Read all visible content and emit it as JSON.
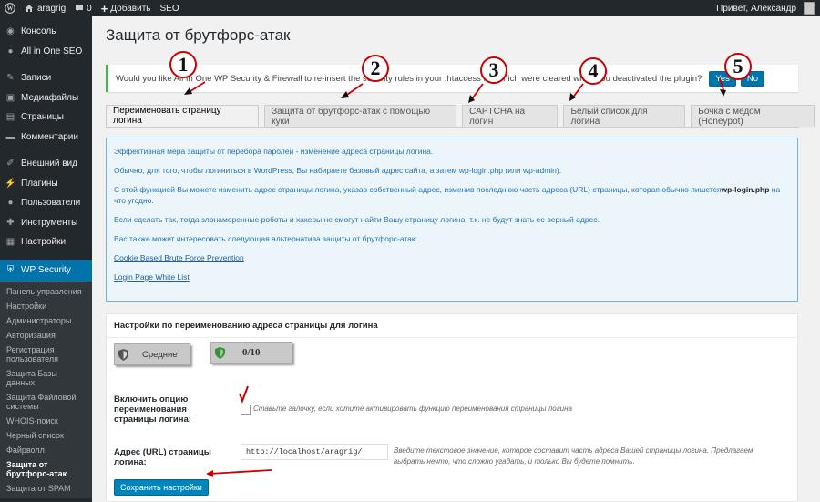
{
  "adminbar": {
    "site": "aragrig",
    "comments": "0",
    "add_new": "Добавить",
    "seo": "SEO",
    "greeting": "Привет, Александр"
  },
  "sidebar": {
    "items": [
      {
        "label": "Консоль",
        "icon": "dashboard-icon"
      },
      {
        "label": "All in One SEO",
        "icon": "seo-icon"
      },
      {
        "label": "Записи",
        "icon": "pin-icon"
      },
      {
        "label": "Медиафайлы",
        "icon": "media-icon"
      },
      {
        "label": "Страницы",
        "icon": "pages-icon"
      },
      {
        "label": "Комментарии",
        "icon": "comments-icon"
      },
      {
        "label": "Внешний вид",
        "icon": "appearance-icon"
      },
      {
        "label": "Плагины",
        "icon": "plugins-icon"
      },
      {
        "label": "Пользователи",
        "icon": "users-icon"
      },
      {
        "label": "Инструменты",
        "icon": "tools-icon"
      },
      {
        "label": "Настройки",
        "icon": "settings-icon"
      },
      {
        "label": "WP Security",
        "icon": "shield-icon"
      }
    ],
    "submenu": [
      "Панель управления",
      "Настройки",
      "Администраторы",
      "Авторизация",
      "Регистрация пользователя",
      "Защита Базы данных",
      "Защита Файловой системы",
      "WHOIS-поиск",
      "Черный список",
      "Файрволл",
      "Защита от брутфорс-атак",
      "Защита от SPAM"
    ]
  },
  "page": {
    "title": "Защита от брутфорс-атак"
  },
  "notice": {
    "text": "Would you like All In One WP Security & Firewall to re-insert the security rules in your .htaccess file which were cleared when you deactivated the plugin?",
    "yes": "Yes",
    "no": "No"
  },
  "tabs": [
    "Переименовать страницу логина",
    "Защита от брутфорс-атак с помощью куки",
    "CAPTCHA на логин",
    "Белый список для логина",
    "Бочка с медом (Honeypot)"
  ],
  "info": {
    "p1": "Эффективная мера защиты от перебора паролей - изменение адреса страницы логина.",
    "p2": "Обычно, для того, чтобы логиниться в WordPress, Вы набираете базовый адрес сайта, а затем wp-login.php (или wp-admin).",
    "p3a": "С этой функцией Вы можете изменить адрес страницы логина, указав собственный адрес, изменив последнюю часть адреса (URL) страницы, которая обычно пишется",
    "p3b": "wp-login.php",
    "p3c": "на что угодно.",
    "p4": "Если сделать так, тогда злонамеренные роботы и хакеры не смогут найти Вашу страницу логина, т.к. не будут знать ее верный адрес.",
    "p5": "Вас также может интересовать следующая альтернатива защиты от брутфорс-атак:",
    "link1": "Cookie Based Brute Force Prevention",
    "link2": "Login Page White List"
  },
  "settings": {
    "header": "Настройки по переименованию адреса страницы для логина",
    "level": "Средние",
    "score": "0/10",
    "enable_label": "Включить опцию переименования страницы логина:",
    "enable_desc": "Ставьте галочку, если хотите активировать функцию переименования страницы логина",
    "url_label": "Адрес (URL) страницы логина:",
    "url_prefix": "http://localhost/aragrig/",
    "url_desc": "Введите текстовое значение, которое составит часть адреса Вашей страницы логина. Предлагаем выбрать нечто, что сложно угадать, и только Вы будете помнить.",
    "save": "Сохранить настройки"
  },
  "annotations": [
    "1",
    "2",
    "3",
    "4",
    "5"
  ],
  "colors": {
    "accent": "#0073aa",
    "annotation": "#cc0000"
  }
}
